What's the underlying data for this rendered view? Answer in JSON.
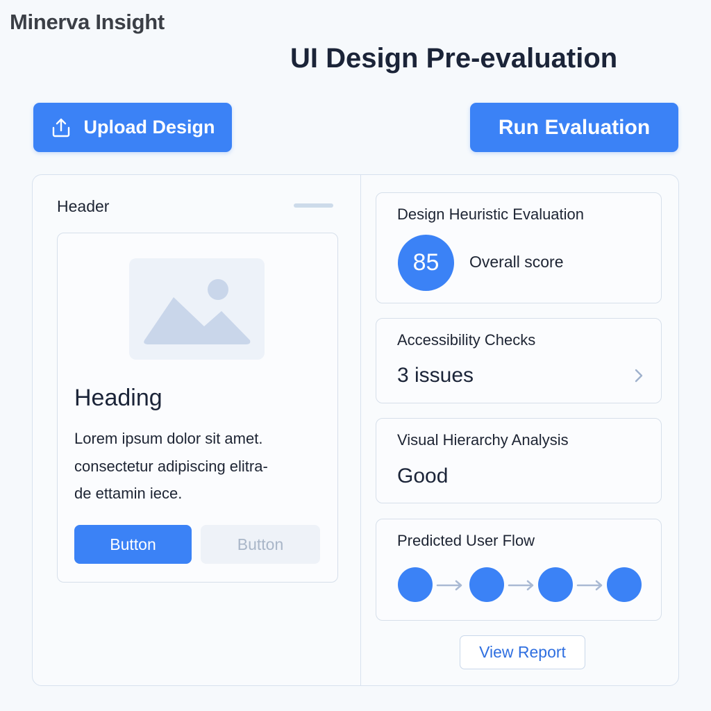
{
  "brand": {
    "name": "Minerva Insight"
  },
  "page": {
    "title": "UI Design Pre-evaluation"
  },
  "toolbar": {
    "upload_label": "Upload Design",
    "upload_icon": "upload-icon",
    "run_label": "Run Evaluation"
  },
  "preview": {
    "header_label": "Header",
    "card": {
      "image_icon": "image-placeholder-icon",
      "heading": "Heading",
      "body_lines": [
        "Lorem ipsum dolor sit amet.",
        "consectetur adipiscing elitra-",
        "de ettamin iece."
      ],
      "primary_button": "Button",
      "secondary_button": "Button"
    }
  },
  "results": {
    "heuristic": {
      "title": "Design Heuristic Evaluation",
      "score": "85",
      "score_label": "Overall score"
    },
    "accessibility": {
      "title": "Accessibility Checks",
      "value": "3 issues",
      "icon": "chevron-right-icon"
    },
    "hierarchy": {
      "title": "Visual Hierarchy Analysis",
      "value": "Good"
    },
    "user_flow": {
      "title": "Predicted User Flow",
      "steps": 4
    },
    "view_report_label": "View Report"
  },
  "colors": {
    "accent": "#3b82f6",
    "background": "#f6f9fc",
    "border": "#d6dfea",
    "flow_arrow": "#a9b9d3"
  }
}
